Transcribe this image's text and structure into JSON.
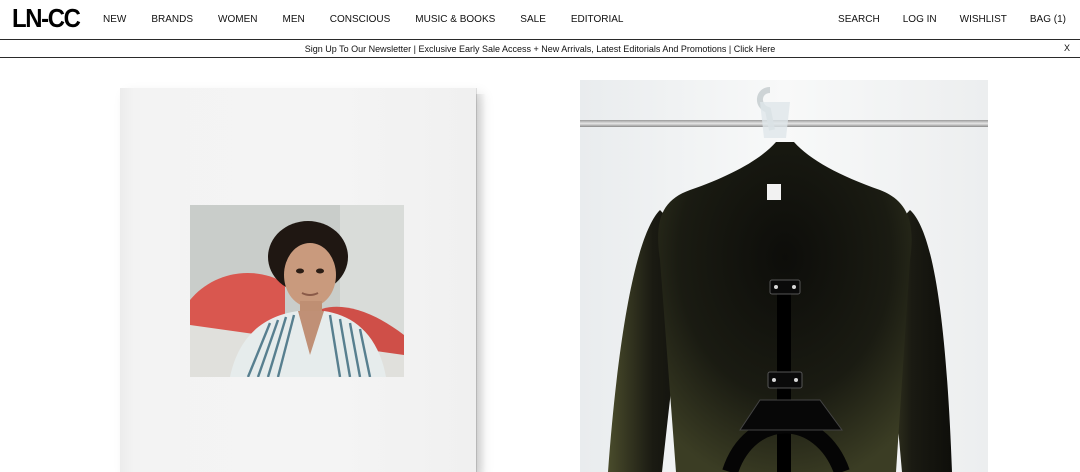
{
  "header": {
    "logo": "LN-CC",
    "nav": [
      "NEW",
      "BRANDS",
      "WOMEN",
      "MEN",
      "CONSCIOUS",
      "MUSIC & BOOKS",
      "SALE",
      "EDITORIAL"
    ],
    "actions": {
      "search": "SEARCH",
      "login": "LOG IN",
      "wishlist": "WISHLIST",
      "bag": "BAG (1)"
    }
  },
  "newsletter": {
    "text": "Sign Up To Our Newsletter | Exclusive Early Sale Access + New Arrivals, Latest Editorials And Promotions | Click Here",
    "close": "X"
  },
  "tiles": [
    {
      "name": "book-cover",
      "icon": "photo-portrait-image"
    },
    {
      "name": "jacket-on-hanger",
      "icon": "garment-image"
    }
  ]
}
